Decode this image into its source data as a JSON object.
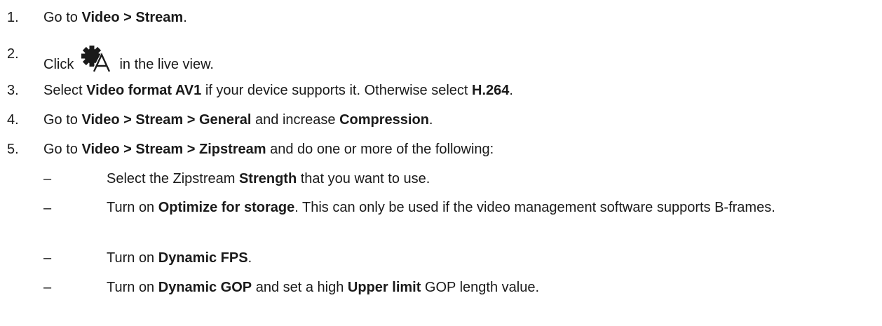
{
  "steps": [
    {
      "num": "1.",
      "pre": "Go to ",
      "b1": "Video > Stream",
      "post": "."
    },
    {
      "num": "2.",
      "pre": "Click ",
      "icon": "gear-with-letter-a-icon",
      "post": " in the live view."
    },
    {
      "num": "3.",
      "pre": "Select ",
      "b1": "Video format AV1",
      "mid": " if your device supports it. Otherwise select ",
      "b2": "H.264",
      "post": "."
    },
    {
      "num": "4.",
      "pre": "Go to ",
      "b1": "Video > Stream > General",
      "mid": " and increase ",
      "b2": "Compression",
      "post": "."
    },
    {
      "num": "5.",
      "pre": "Go to ",
      "b1": "Video > Stream > Zipstream",
      "post": " and do one or more of the following:"
    }
  ],
  "substeps": [
    {
      "dash": "–",
      "pre": "Select the Zipstream ",
      "b1": "Strength",
      "post": " that you want to use."
    },
    {
      "dash": "–",
      "pre": "Turn on ",
      "b1": "Optimize for storage",
      "post": ". This can only be used if the video management software supports B-frames."
    },
    {
      "dash": "–",
      "pre": "Turn on ",
      "b1": "Dynamic FPS",
      "post": "."
    },
    {
      "dash": "–",
      "pre": "Turn on ",
      "b1": "Dynamic GOP",
      "mid": " and set a high ",
      "b2": "Upper limit",
      "post": " GOP length value."
    }
  ]
}
